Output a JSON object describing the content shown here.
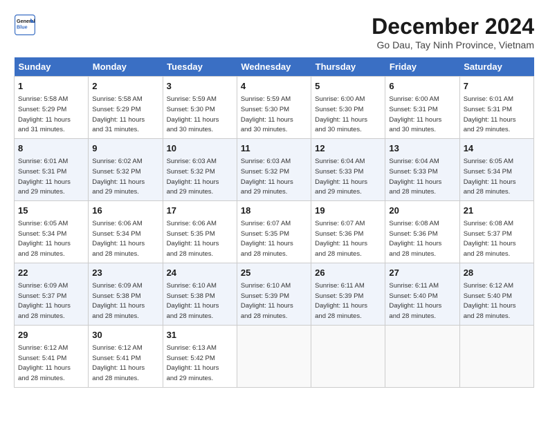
{
  "header": {
    "logo_line1": "General",
    "logo_line2": "Blue",
    "month_title": "December 2024",
    "location": "Go Dau, Tay Ninh Province, Vietnam"
  },
  "days_of_week": [
    "Sunday",
    "Monday",
    "Tuesday",
    "Wednesday",
    "Thursday",
    "Friday",
    "Saturday"
  ],
  "weeks": [
    [
      {
        "day": "1",
        "info": "Sunrise: 5:58 AM\nSunset: 5:29 PM\nDaylight: 11 hours\nand 31 minutes."
      },
      {
        "day": "2",
        "info": "Sunrise: 5:58 AM\nSunset: 5:29 PM\nDaylight: 11 hours\nand 31 minutes."
      },
      {
        "day": "3",
        "info": "Sunrise: 5:59 AM\nSunset: 5:30 PM\nDaylight: 11 hours\nand 30 minutes."
      },
      {
        "day": "4",
        "info": "Sunrise: 5:59 AM\nSunset: 5:30 PM\nDaylight: 11 hours\nand 30 minutes."
      },
      {
        "day": "5",
        "info": "Sunrise: 6:00 AM\nSunset: 5:30 PM\nDaylight: 11 hours\nand 30 minutes."
      },
      {
        "day": "6",
        "info": "Sunrise: 6:00 AM\nSunset: 5:31 PM\nDaylight: 11 hours\nand 30 minutes."
      },
      {
        "day": "7",
        "info": "Sunrise: 6:01 AM\nSunset: 5:31 PM\nDaylight: 11 hours\nand 29 minutes."
      }
    ],
    [
      {
        "day": "8",
        "info": "Sunrise: 6:01 AM\nSunset: 5:31 PM\nDaylight: 11 hours\nand 29 minutes."
      },
      {
        "day": "9",
        "info": "Sunrise: 6:02 AM\nSunset: 5:32 PM\nDaylight: 11 hours\nand 29 minutes."
      },
      {
        "day": "10",
        "info": "Sunrise: 6:03 AM\nSunset: 5:32 PM\nDaylight: 11 hours\nand 29 minutes."
      },
      {
        "day": "11",
        "info": "Sunrise: 6:03 AM\nSunset: 5:32 PM\nDaylight: 11 hours\nand 29 minutes."
      },
      {
        "day": "12",
        "info": "Sunrise: 6:04 AM\nSunset: 5:33 PM\nDaylight: 11 hours\nand 29 minutes."
      },
      {
        "day": "13",
        "info": "Sunrise: 6:04 AM\nSunset: 5:33 PM\nDaylight: 11 hours\nand 28 minutes."
      },
      {
        "day": "14",
        "info": "Sunrise: 6:05 AM\nSunset: 5:34 PM\nDaylight: 11 hours\nand 28 minutes."
      }
    ],
    [
      {
        "day": "15",
        "info": "Sunrise: 6:05 AM\nSunset: 5:34 PM\nDaylight: 11 hours\nand 28 minutes."
      },
      {
        "day": "16",
        "info": "Sunrise: 6:06 AM\nSunset: 5:34 PM\nDaylight: 11 hours\nand 28 minutes."
      },
      {
        "day": "17",
        "info": "Sunrise: 6:06 AM\nSunset: 5:35 PM\nDaylight: 11 hours\nand 28 minutes."
      },
      {
        "day": "18",
        "info": "Sunrise: 6:07 AM\nSunset: 5:35 PM\nDaylight: 11 hours\nand 28 minutes."
      },
      {
        "day": "19",
        "info": "Sunrise: 6:07 AM\nSunset: 5:36 PM\nDaylight: 11 hours\nand 28 minutes."
      },
      {
        "day": "20",
        "info": "Sunrise: 6:08 AM\nSunset: 5:36 PM\nDaylight: 11 hours\nand 28 minutes."
      },
      {
        "day": "21",
        "info": "Sunrise: 6:08 AM\nSunset: 5:37 PM\nDaylight: 11 hours\nand 28 minutes."
      }
    ],
    [
      {
        "day": "22",
        "info": "Sunrise: 6:09 AM\nSunset: 5:37 PM\nDaylight: 11 hours\nand 28 minutes."
      },
      {
        "day": "23",
        "info": "Sunrise: 6:09 AM\nSunset: 5:38 PM\nDaylight: 11 hours\nand 28 minutes."
      },
      {
        "day": "24",
        "info": "Sunrise: 6:10 AM\nSunset: 5:38 PM\nDaylight: 11 hours\nand 28 minutes."
      },
      {
        "day": "25",
        "info": "Sunrise: 6:10 AM\nSunset: 5:39 PM\nDaylight: 11 hours\nand 28 minutes."
      },
      {
        "day": "26",
        "info": "Sunrise: 6:11 AM\nSunset: 5:39 PM\nDaylight: 11 hours\nand 28 minutes."
      },
      {
        "day": "27",
        "info": "Sunrise: 6:11 AM\nSunset: 5:40 PM\nDaylight: 11 hours\nand 28 minutes."
      },
      {
        "day": "28",
        "info": "Sunrise: 6:12 AM\nSunset: 5:40 PM\nDaylight: 11 hours\nand 28 minutes."
      }
    ],
    [
      {
        "day": "29",
        "info": "Sunrise: 6:12 AM\nSunset: 5:41 PM\nDaylight: 11 hours\nand 28 minutes."
      },
      {
        "day": "30",
        "info": "Sunrise: 6:12 AM\nSunset: 5:41 PM\nDaylight: 11 hours\nand 28 minutes."
      },
      {
        "day": "31",
        "info": "Sunrise: 6:13 AM\nSunset: 5:42 PM\nDaylight: 11 hours\nand 29 minutes."
      },
      {
        "day": "",
        "info": ""
      },
      {
        "day": "",
        "info": ""
      },
      {
        "day": "",
        "info": ""
      },
      {
        "day": "",
        "info": ""
      }
    ]
  ]
}
